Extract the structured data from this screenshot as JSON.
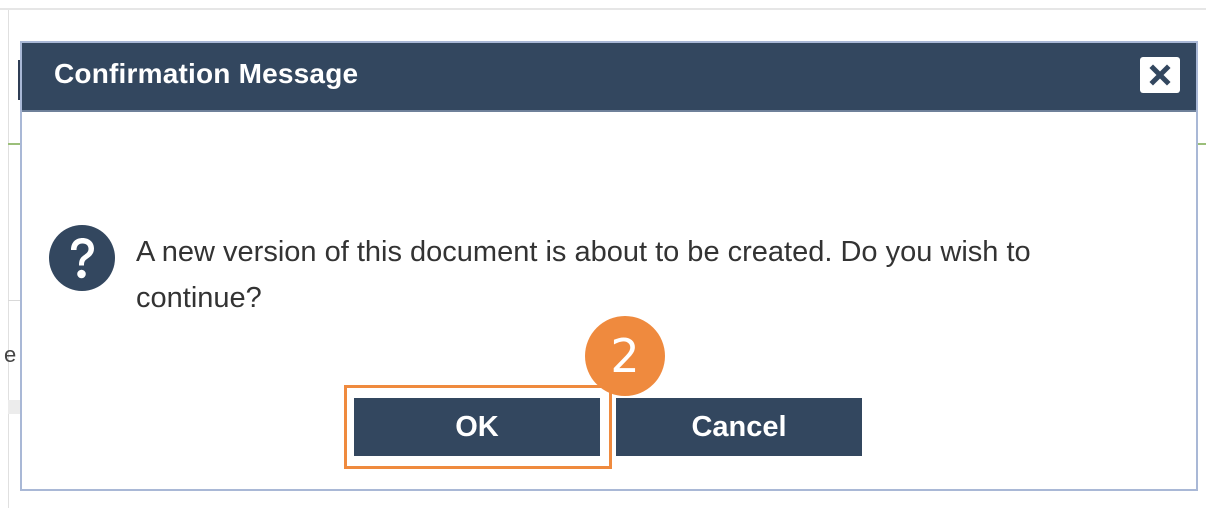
{
  "dialog": {
    "title": "Confirmation Message",
    "close_icon": "close-icon",
    "question_icon": "question-icon",
    "message": "A new version of this document is about to be created. Do you wish to continue?",
    "ok_label": "OK",
    "cancel_label": "Cancel"
  },
  "annotation": {
    "step_number": "2"
  },
  "background": {
    "partial_letter": "e"
  },
  "colors": {
    "header_bg": "#33475f",
    "button_bg": "#33475f",
    "highlight": "#ef8a3e",
    "dialog_border": "#a9b8d6"
  }
}
